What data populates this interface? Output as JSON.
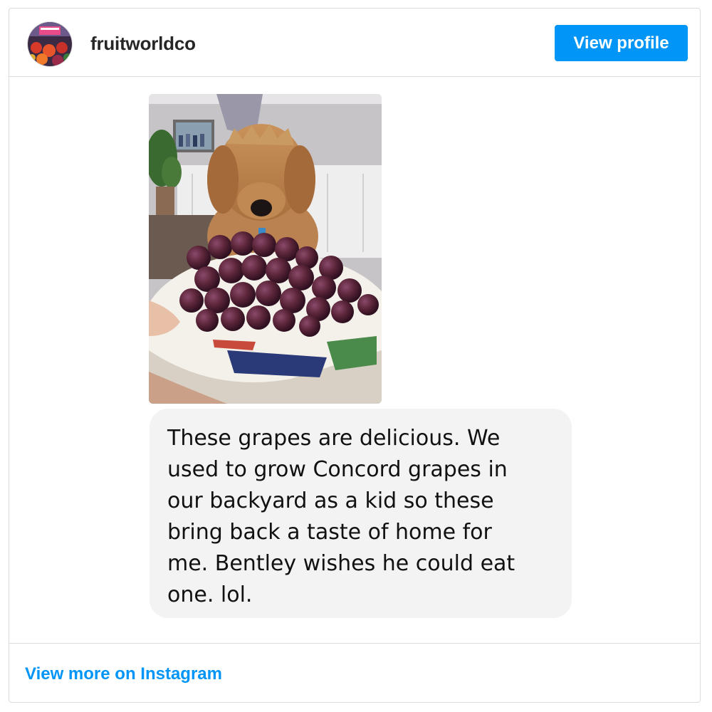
{
  "header": {
    "username": "fruitworldco",
    "view_profile_label": "View profile",
    "avatar_icon": "profile-avatar"
  },
  "post": {
    "image_icon": "dog-with-grapes-photo",
    "comment_text": "These grapes are delicious. We\nused to grow Concord grapes in\nour backyard as a kid so these\nbring back a taste of home for\nme. Bentley wishes he could eat\none. lol."
  },
  "footer": {
    "view_more_label": "View more on Instagram"
  },
  "colors": {
    "accent": "#0095f6",
    "border": "#dbdbdb",
    "bubble": "#f3f3f3"
  }
}
